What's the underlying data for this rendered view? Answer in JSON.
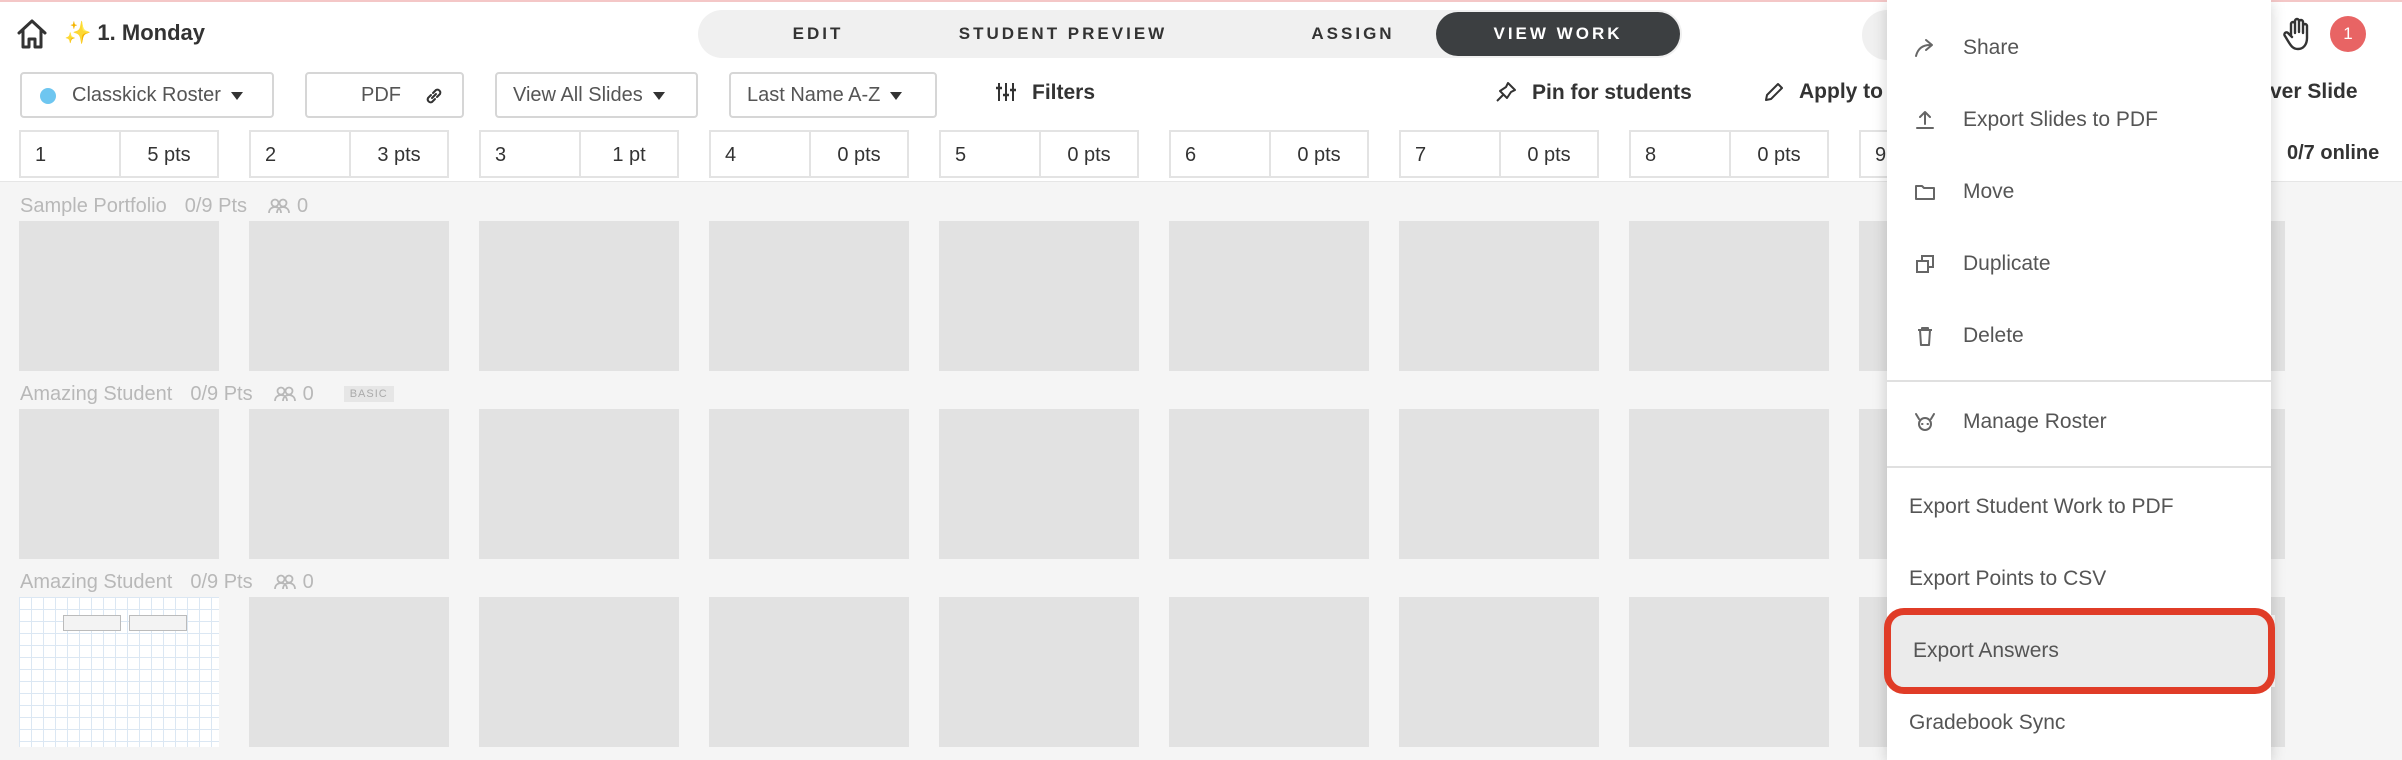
{
  "header": {
    "lesson_spark": "✨",
    "lesson_title": "1. Monday",
    "notification_count": "1"
  },
  "mode_tabs": [
    {
      "label": "EDIT",
      "active": false
    },
    {
      "label": "STUDENT PREVIEW",
      "active": false
    },
    {
      "label": "ASSIGN",
      "active": false
    },
    {
      "label": "VIEW WORK",
      "active": true
    }
  ],
  "toolbar": {
    "roster_label": "Classkick Roster",
    "pdf_label": "PDF",
    "view_slides_label": "View All Slides",
    "sort_label": "Last Name A-Z",
    "filters_label": "Filters",
    "pin_label": "Pin for students",
    "apply_label": "Apply to",
    "cover_label": "Cover Slide",
    "online_count": "0/7 online"
  },
  "slides": [
    {
      "num": "1",
      "pts": "5 pts"
    },
    {
      "num": "2",
      "pts": "3 pts"
    },
    {
      "num": "3",
      "pts": "1 pt"
    },
    {
      "num": "4",
      "pts": "0 pts"
    },
    {
      "num": "5",
      "pts": "0 pts"
    },
    {
      "num": "6",
      "pts": "0 pts"
    },
    {
      "num": "7",
      "pts": "0 pts"
    },
    {
      "num": "8",
      "pts": "0 pts"
    },
    {
      "num": "9",
      "pts": ""
    }
  ],
  "students": [
    {
      "name": "Sample Portfolio",
      "pts": "0/9 Pts",
      "group": "0",
      "badge": ""
    },
    {
      "name": "Amazing Student",
      "pts": "0/9 Pts",
      "group": "0",
      "badge": "BASIC"
    },
    {
      "name": "Amazing Student",
      "pts": "0/9 Pts",
      "group": "0",
      "badge": ""
    }
  ],
  "menu": {
    "share": "Share",
    "export_slides": "Export Slides to PDF",
    "move": "Move",
    "duplicate": "Duplicate",
    "delete": "Delete",
    "manage_roster": "Manage Roster",
    "export_work": "Export Student Work to PDF",
    "export_points": "Export Points to CSV",
    "export_answers": "Export Answers",
    "gradebook_sync": "Gradebook Sync"
  },
  "colors": {
    "accent_dark": "#3c3f41",
    "badge_red": "#e86464",
    "highlight_ring": "#e03c27",
    "roster_dot": "#6ec6f0"
  }
}
